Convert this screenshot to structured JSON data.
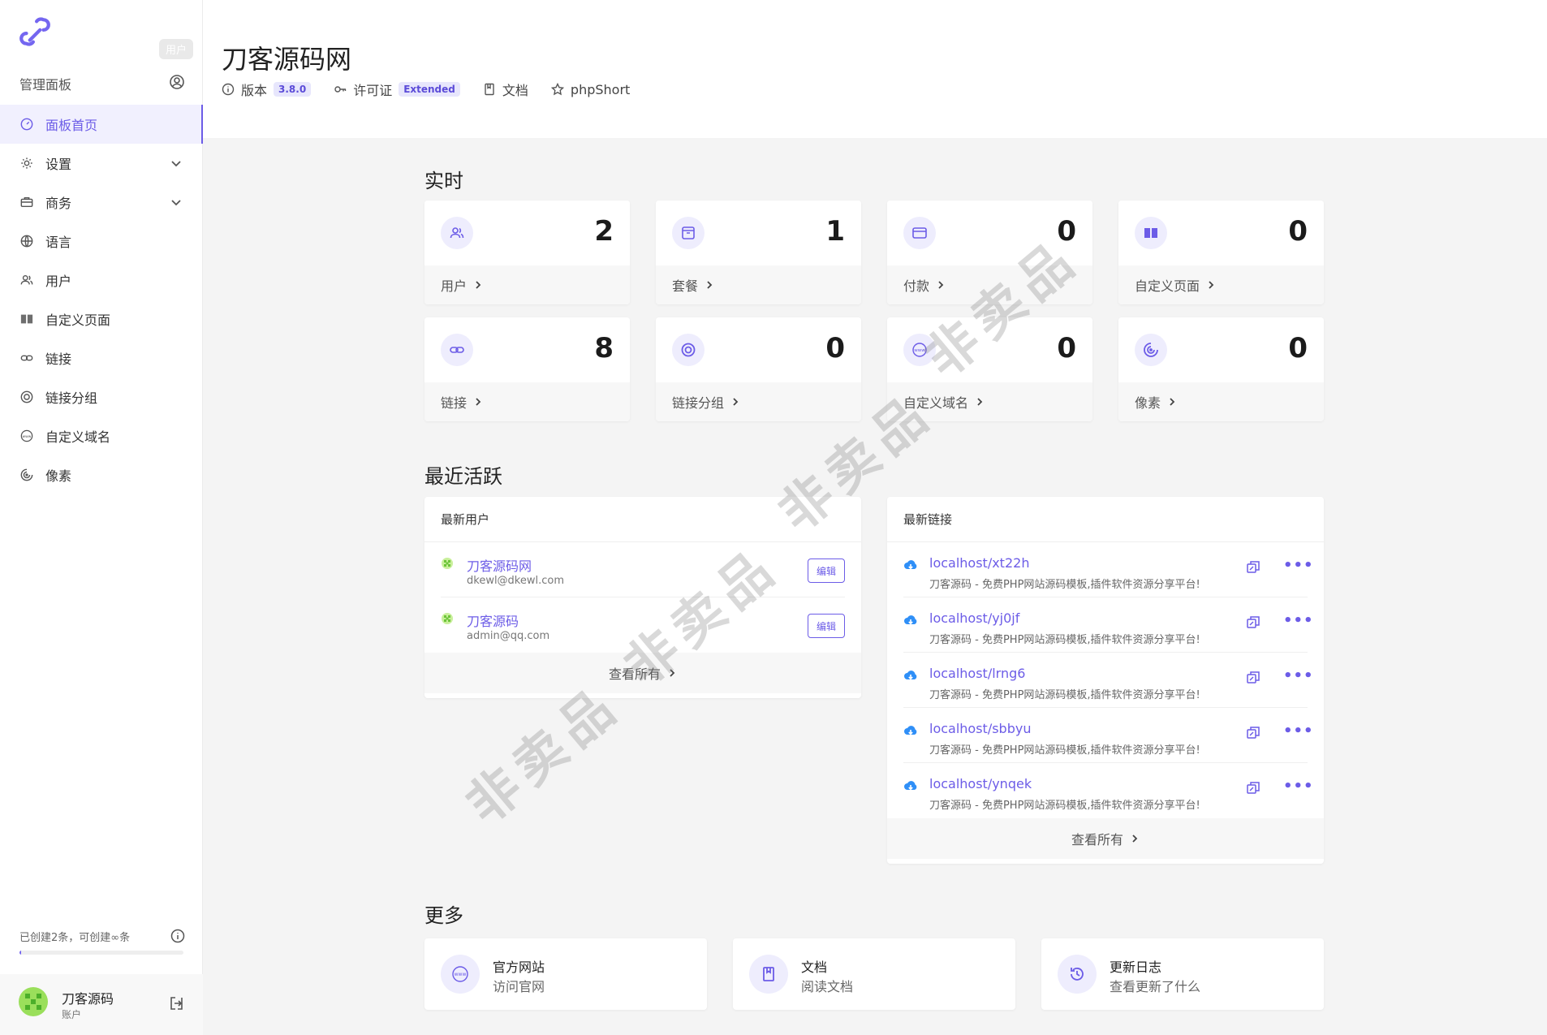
{
  "sidebar": {
    "panel_title": "管理面板",
    "tooltip": "用户",
    "items": [
      {
        "label": "面板首页",
        "active": true
      },
      {
        "label": "设置",
        "has_submenu": true
      },
      {
        "label": "商务",
        "has_submenu": true
      },
      {
        "label": "语言"
      },
      {
        "label": "用户"
      },
      {
        "label": "自定义页面"
      },
      {
        "label": "链接"
      },
      {
        "label": "链接分组"
      },
      {
        "label": "自定义域名"
      },
      {
        "label": "像素"
      }
    ],
    "quota_text": "已创建2条，可创建∞条",
    "quota_fraction": 0.01,
    "account_name": "刀客源码",
    "account_sub": "账户"
  },
  "header": {
    "title": "刀客源码网",
    "version_label": "版本",
    "version_value": "3.8.0",
    "license_label": "许可证",
    "license_value": "Extended",
    "docs_label": "文档",
    "product_label": "phpShort"
  },
  "realtime": {
    "title": "实时",
    "stats": [
      {
        "label": "用户",
        "value": "2",
        "icon": "users-icon"
      },
      {
        "label": "套餐",
        "value": "1",
        "icon": "package-icon"
      },
      {
        "label": "付款",
        "value": "0",
        "icon": "card-icon"
      },
      {
        "label": "自定义页面",
        "value": "0",
        "icon": "book-icon"
      },
      {
        "label": "链接",
        "value": "8",
        "icon": "link-icon"
      },
      {
        "label": "链接分组",
        "value": "0",
        "icon": "target-icon"
      },
      {
        "label": "自定义域名",
        "value": "0",
        "icon": "www-icon"
      },
      {
        "label": "像素",
        "value": "0",
        "icon": "pixel-icon"
      }
    ]
  },
  "recent": {
    "title": "最近活跃",
    "latest_users_title": "最新用户",
    "users": [
      {
        "name": "刀客源码网",
        "email": "dkewl@dkewl.com",
        "edit": "编辑"
      },
      {
        "name": "刀客源码",
        "email": "admin@qq.com",
        "edit": "编辑"
      }
    ],
    "view_all": "查看所有",
    "latest_links_title": "最新链接",
    "links": [
      {
        "url": "localhost/xt22h",
        "desc": "刀客源码 - 免费PHP网站源码模板,插件软件资源分享平台!"
      },
      {
        "url": "localhost/yj0jf",
        "desc": "刀客源码 - 免费PHP网站源码模板,插件软件资源分享平台!"
      },
      {
        "url": "localhost/lrng6",
        "desc": "刀客源码 - 免费PHP网站源码模板,插件软件资源分享平台!"
      },
      {
        "url": "localhost/sbbyu",
        "desc": "刀客源码 - 免费PHP网站源码模板,插件软件资源分享平台!"
      },
      {
        "url": "localhost/ynqek",
        "desc": "刀客源码 - 免费PHP网站源码模板,插件软件资源分享平台!"
      }
    ],
    "more_glyph": "•••"
  },
  "more": {
    "title": "更多",
    "cards": [
      {
        "title": "官方网站",
        "sub": "访问官网",
        "icon": "www-icon"
      },
      {
        "title": "文档",
        "sub": "阅读文档",
        "icon": "book-icon"
      },
      {
        "title": "更新日志",
        "sub": "查看更新了什么",
        "icon": "history-icon"
      }
    ]
  },
  "watermark": "非卖品",
  "colors": {
    "accent": "#6c5ce7",
    "download": "#2f8ff7"
  }
}
